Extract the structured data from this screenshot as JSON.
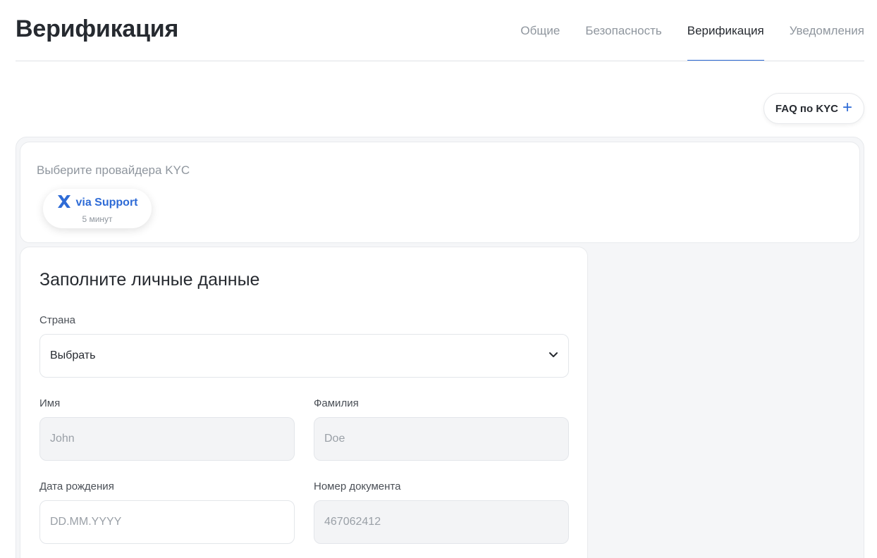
{
  "header": {
    "title": "Верификация",
    "tabs": [
      {
        "label": "Общие",
        "active": false
      },
      {
        "label": "Безопасность",
        "active": false
      },
      {
        "label": "Верификация",
        "active": true
      },
      {
        "label": "Уведомления",
        "active": false
      }
    ]
  },
  "faq": {
    "label": "FAQ по KYC",
    "icon": "plus-icon"
  },
  "provider": {
    "label": "Выберите провайдера KYC",
    "chip": {
      "name": "via Support",
      "duration": "5 минут",
      "icon": "x-logo-icon"
    }
  },
  "form": {
    "title": "Заполните личные данные",
    "country": {
      "label": "Страна",
      "value": "Выбрать"
    },
    "first_name": {
      "label": "Имя",
      "value": "John"
    },
    "last_name": {
      "label": "Фамилия",
      "value": "Doe"
    },
    "birth_date": {
      "label": "Дата рождения",
      "value": "DD.MM.YYYY"
    },
    "document": {
      "label": "Номер документа",
      "value": "467062412"
    }
  },
  "colors": {
    "accent": "#2e6bd6",
    "text": "#262a30",
    "muted": "#8f969e"
  }
}
